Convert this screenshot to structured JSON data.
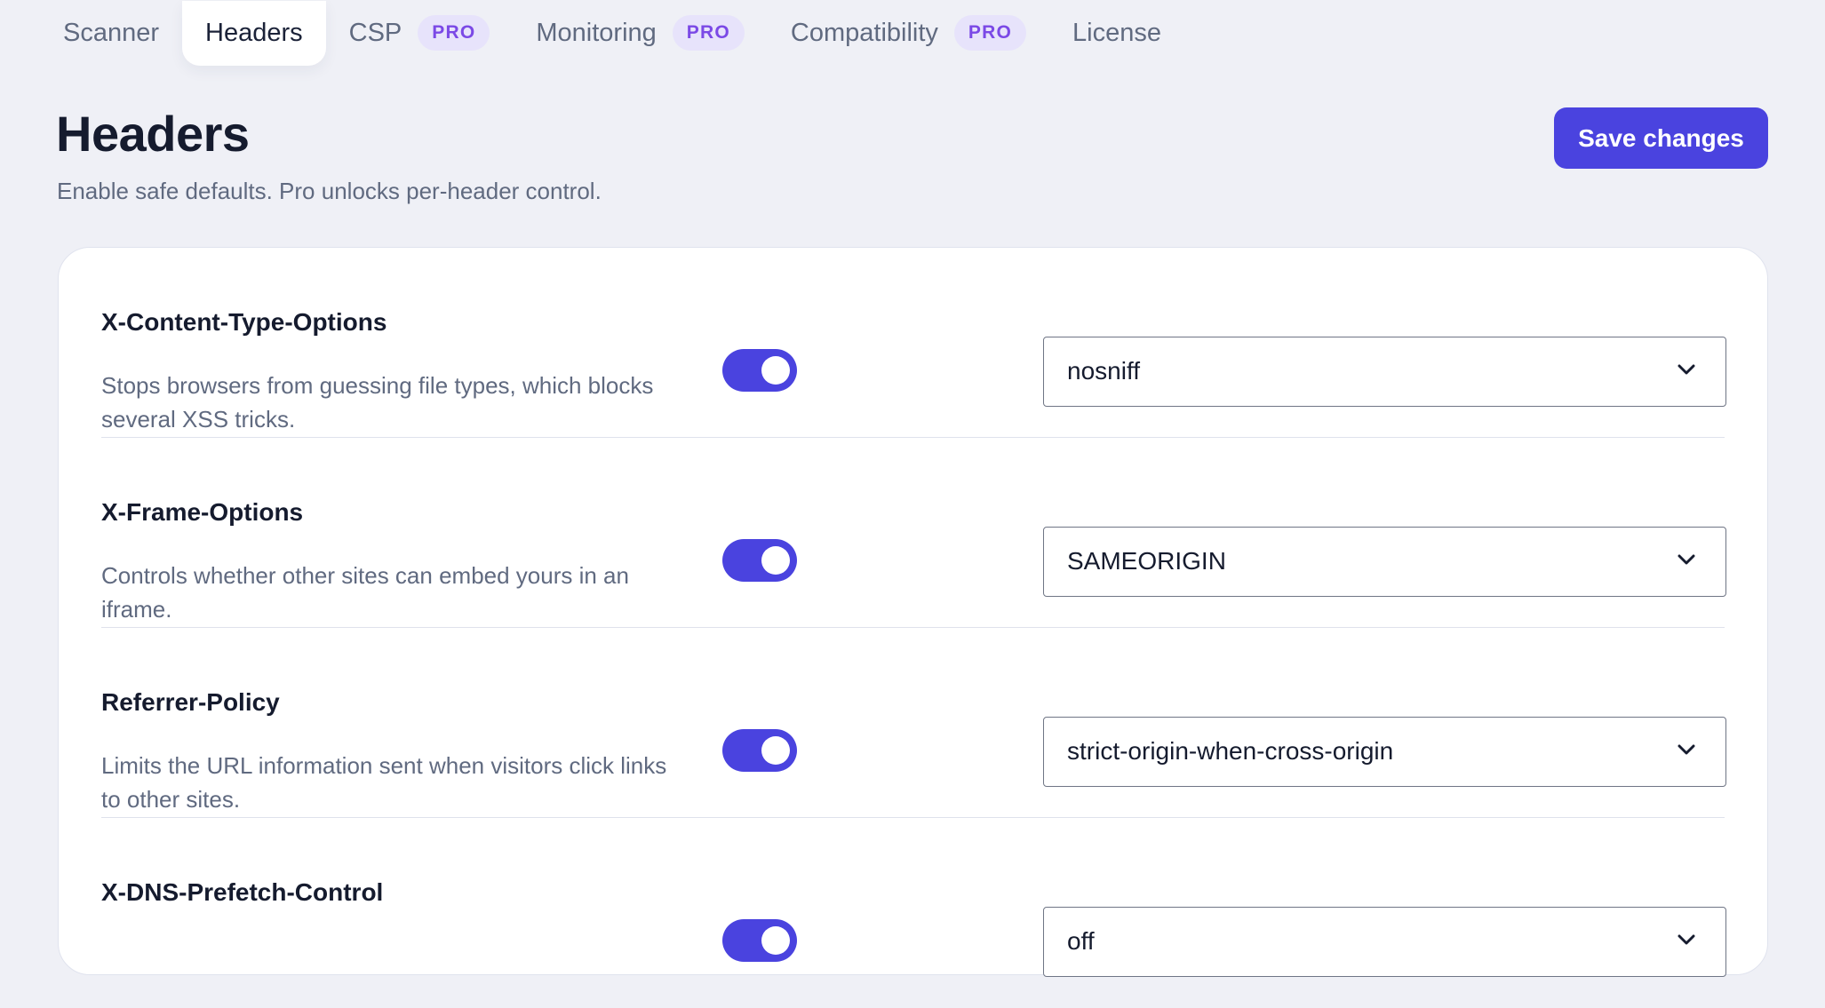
{
  "tabs": [
    {
      "label": "Scanner",
      "active": false,
      "pro": false
    },
    {
      "label": "Headers",
      "active": true,
      "pro": false
    },
    {
      "label": "CSP",
      "active": false,
      "pro": true
    },
    {
      "label": "Monitoring",
      "active": false,
      "pro": true
    },
    {
      "label": "Compatibility",
      "active": false,
      "pro": true
    },
    {
      "label": "License",
      "active": false,
      "pro": false
    }
  ],
  "pro_badge": "PRO",
  "page": {
    "title": "Headers",
    "subtitle": "Enable safe defaults. Pro unlocks per-header control.",
    "save_label": "Save changes"
  },
  "headers": [
    {
      "name": "X-Content-Type-Options",
      "description": "Stops browsers from guessing file types, which blocks several XSS tricks.",
      "enabled": true,
      "value": "nosniff"
    },
    {
      "name": "X-Frame-Options",
      "description": "Controls whether other sites can embed yours in an iframe.",
      "enabled": true,
      "value": "SAMEORIGIN"
    },
    {
      "name": "Referrer-Policy",
      "description": "Limits the URL information sent when visitors click links to other sites.",
      "enabled": true,
      "value": "strict-origin-when-cross-origin"
    },
    {
      "name": "X-DNS-Prefetch-Control",
      "description": "",
      "enabled": true,
      "value": "off"
    }
  ],
  "colors": {
    "accent": "#4a43df",
    "pro_badge_bg": "#e7e3fb",
    "pro_badge_text": "#7b49e6",
    "page_bg": "#eff0f6"
  },
  "icons": {
    "select_chevron": "chevron-down-icon"
  }
}
